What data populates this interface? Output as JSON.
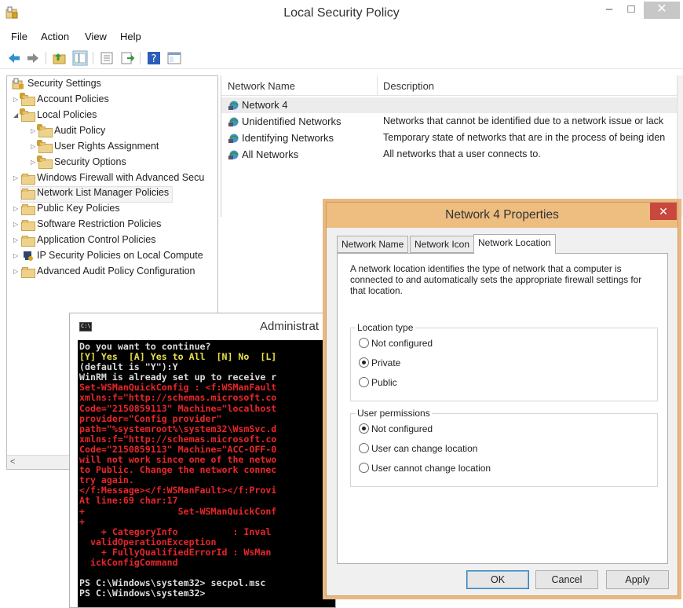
{
  "window": {
    "title": "Local Security Policy",
    "minimize": "–",
    "maximize": "□",
    "close": "✕"
  },
  "menu": [
    "File",
    "Action",
    "View",
    "Help"
  ],
  "toolbar": [
    "back-arrow-icon",
    "forward-arrow-icon",
    "up-folder-icon",
    "show-hide-tree-icon",
    "properties-icon",
    "export-list-icon",
    "help-icon",
    "console-tree-icon"
  ],
  "tree": {
    "root": "Security Settings",
    "items": [
      "Account Policies",
      "Local Policies",
      "Audit Policy",
      "User Rights Assignment",
      "Security Options",
      "Windows Firewall with Advanced Secu",
      "Network List Manager Policies",
      "Public Key Policies",
      "Software Restriction Policies",
      "Application Control Policies",
      "IP Security Policies on Local Compute",
      "Advanced Audit Policy Configuration"
    ],
    "scroll_left": "<"
  },
  "list": {
    "columns": [
      "Network Name",
      "Description"
    ],
    "rows": [
      {
        "name": "Network  4",
        "description": ""
      },
      {
        "name": "Unidentified Networks",
        "description": "Networks that cannot be identified due to a network issue or lack"
      },
      {
        "name": "Identifying Networks",
        "description": "Temporary state of networks that are in the process of being iden"
      },
      {
        "name": "All Networks",
        "description": "All networks that a user connects to."
      }
    ]
  },
  "console": {
    "title": "Administrat",
    "lines": [
      {
        "text": "Do you want to continue?",
        "color": "white"
      },
      {
        "text": "[Y] Yes  [A] Yes to All  [N] No  [L]",
        "color": "yellow"
      },
      {
        "text": "(default is \"Y\"):Y",
        "color": "white"
      },
      {
        "text": "WinRM is already set up to receive r",
        "color": "white"
      },
      {
        "text": "Set-WSManQuickConfig : <f:WSManFault",
        "color": "red"
      },
      {
        "text": "xmlns:f=\"http://schemas.microsoft.co",
        "color": "red"
      },
      {
        "text": "Code=\"2150859113\" Machine=\"localhost",
        "color": "red"
      },
      {
        "text": "provider=\"Config provider\"",
        "color": "red"
      },
      {
        "text": "path=\"%systemroot%\\system32\\WsmSvc.d",
        "color": "red"
      },
      {
        "text": "xmlns:f=\"http://schemas.microsoft.co",
        "color": "red"
      },
      {
        "text": "Code=\"2150859113\" Machine=\"ACC-OFF-0",
        "color": "red"
      },
      {
        "text": "will not work since one of the netwo",
        "color": "red"
      },
      {
        "text": "to Public. Change the network connec",
        "color": "red"
      },
      {
        "text": "try again.",
        "color": "red"
      },
      {
        "text": "</f:Message></f:WSManFault></f:Provi",
        "color": "red"
      },
      {
        "text": "At line:69 char:17",
        "color": "red"
      },
      {
        "text": "+                 Set-WSManQuickConf",
        "color": "red"
      },
      {
        "text": "+",
        "color": "red"
      },
      {
        "text": "    + CategoryInfo          : Inval",
        "color": "red"
      },
      {
        "text": "  validOperationException",
        "color": "red"
      },
      {
        "text": "    + FullyQualifiedErrorId : WsMan",
        "color": "red"
      },
      {
        "text": "  ickConfigCommand",
        "color": "red"
      },
      {
        "text": "",
        "color": "white"
      },
      {
        "text": "PS C:\\Windows\\system32> secpol.msc",
        "color": "white"
      },
      {
        "text": "PS C:\\Windows\\system32>",
        "color": "white"
      }
    ]
  },
  "dialog": {
    "title": "Network  4 Properties",
    "close": "✕",
    "tabs": [
      "Network Name",
      "Network Icon",
      "Network Location"
    ],
    "active_tab": "Network Location",
    "description": "A network location identifies the type of network that a computer is connected to and automatically sets the appropriate firewall settings for that location.",
    "location_type": {
      "label": "Location type",
      "options": [
        "Not configured",
        "Private",
        "Public"
      ],
      "selected": "Private"
    },
    "user_permissions": {
      "label": "User permissions",
      "options": [
        "Not configured",
        "User can change location",
        "User cannot change location"
      ],
      "selected": "Not configured"
    },
    "buttons": {
      "ok": "OK",
      "cancel": "Cancel",
      "apply": "Apply"
    }
  }
}
